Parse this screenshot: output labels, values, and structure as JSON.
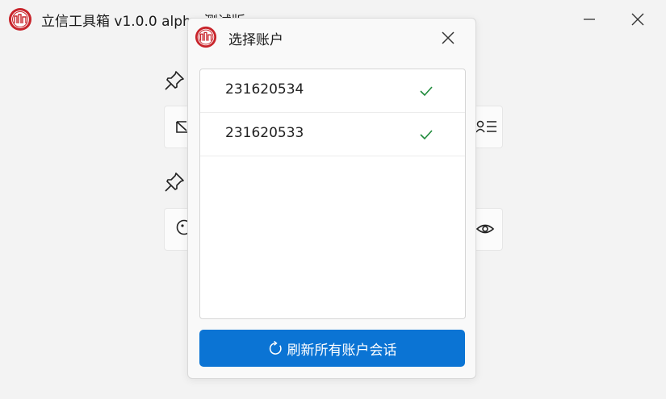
{
  "window": {
    "title": "立信工具箱 v1.0.0 alpha 测试版",
    "icons": {
      "logo": "app-logo-icon",
      "minimize": "minimize-icon",
      "close": "close-icon"
    }
  },
  "background": {
    "pin_icon": "pin-icon",
    "cards": [
      {
        "left_icon": "folder-icon",
        "right_icon": "list-icon"
      },
      {
        "left_icon": "info-circle-icon",
        "right_icon": "eye-icon"
      }
    ]
  },
  "dialog": {
    "title": "选择账户",
    "icons": {
      "logo": "app-logo-icon",
      "close": "close-icon",
      "check": "check-icon",
      "refresh": "refresh-icon"
    },
    "accounts": [
      {
        "id": "231620534",
        "selected": true
      },
      {
        "id": "231620533",
        "selected": true
      }
    ],
    "refresh_label": "刷新所有账户会话"
  },
  "colors": {
    "accent": "#0b74d4",
    "check": "#1e8a3a",
    "logo_red": "#c8242b",
    "background": "#f3f3f3"
  }
}
